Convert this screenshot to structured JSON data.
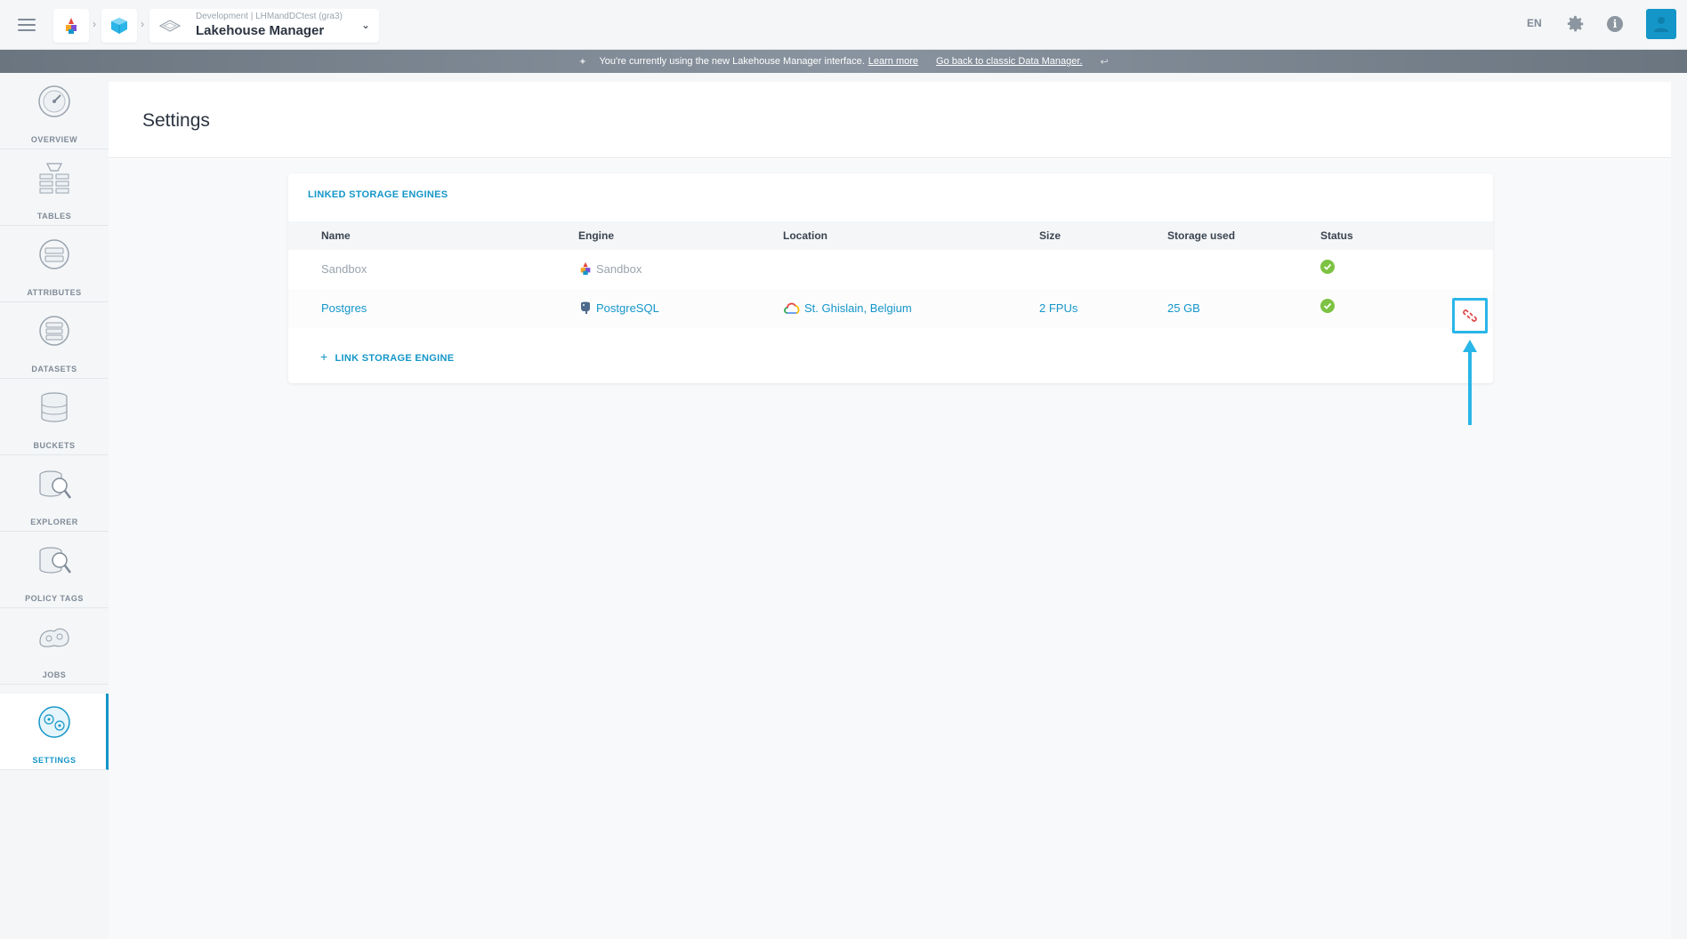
{
  "topbar": {
    "breadcrumb_sub": "Development | LHMandDCtest (gra3)",
    "breadcrumb_main": "Lakehouse Manager",
    "lang": "EN",
    "icons": [
      "menu-icon",
      "forepaas-logo-icon",
      "lakehouse-cube-icon",
      "data-manager-icon",
      "chevron-down-icon",
      "gear-icon",
      "info-icon",
      "user-icon"
    ]
  },
  "banner": {
    "text": "You're currently using the new Lakehouse Manager interface.",
    "learn_more": "Learn more",
    "go_back": "Go back to classic Data Manager."
  },
  "sidebar": {
    "items": [
      {
        "label": "OVERVIEW",
        "icon": "gauge-icon"
      },
      {
        "label": "TABLES",
        "icon": "tables-icon"
      },
      {
        "label": "ATTRIBUTES",
        "icon": "attributes-icon"
      },
      {
        "label": "DATASETS",
        "icon": "datasets-icon"
      },
      {
        "label": "BUCKETS",
        "icon": "buckets-icon"
      },
      {
        "label": "EXPLORER",
        "icon": "explorer-icon"
      },
      {
        "label": "POLICY TAGS",
        "icon": "policy-tags-icon"
      },
      {
        "label": "JOBS",
        "icon": "jobs-icon"
      },
      {
        "label": "SETTINGS",
        "icon": "settings-icon",
        "active": true
      }
    ]
  },
  "page": {
    "title": "Settings"
  },
  "storage": {
    "card_title": "LINKED STORAGE ENGINES",
    "headers": {
      "name": "Name",
      "engine": "Engine",
      "location": "Location",
      "size": "Size",
      "storage_used": "Storage used",
      "status": "Status"
    },
    "rows": [
      {
        "name": "Sandbox",
        "engine": "Sandbox",
        "location": "",
        "size": "",
        "storage_used": "",
        "status": "ok"
      },
      {
        "name": "Postgres",
        "engine": "PostgreSQL",
        "location": "St. Ghislain, Belgium",
        "size": "2 FPUs",
        "storage_used": "25 GB",
        "status": "ok"
      }
    ],
    "link_label": "LINK STORAGE ENGINE"
  },
  "colors": {
    "accent": "#1496c8",
    "highlight": "#29b6e8",
    "status_ok": "#7dc242",
    "unlink": "#e04040"
  }
}
